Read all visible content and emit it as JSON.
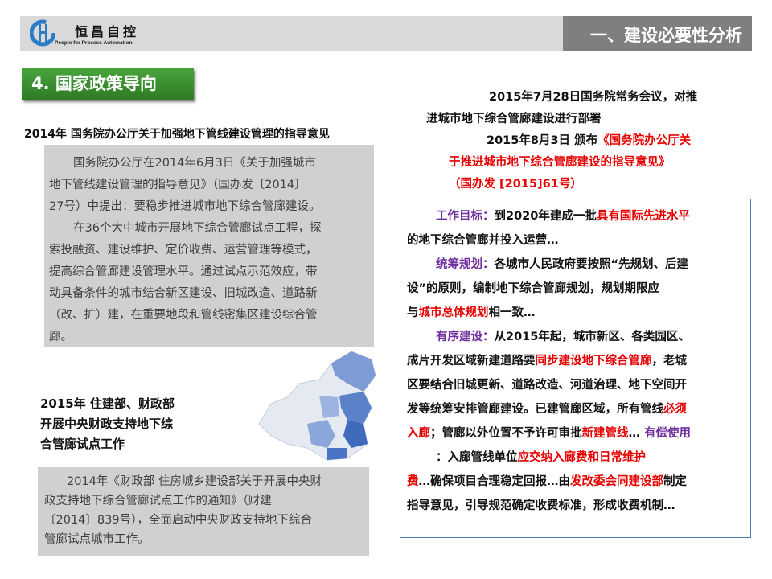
{
  "header": {
    "logo_cn": "恒昌自控",
    "logo_en": "People for Process Automation",
    "section_title": "一、建设必要性分析"
  },
  "tag": "4. 国家政策导向",
  "policy_2014": {
    "title": "2014年 国务院办公厅关于加强地下管线建设管理的指导意见",
    "lines": [
      "国务院办公厅在2014年6月3日《关于加强城市",
      "地下管线建设管理的指导意见》（国办发〔2014〕",
      "27号）中提出：要稳步推进城市地下综合管廊建设。",
      "在36个大中城市开展地下综合管廊试点工程，探",
      "索投融资、建设维护、定价收费、运营管理等模式，",
      "提高综合管廊建设管理水平。通过试点示范效应，带",
      "动具备条件的城市结合新区建设、旧城改造、道路新",
      "（改、扩）建，在重要地段和管线密集区建设综合管",
      "廊。"
    ]
  },
  "policy_2015": {
    "title_lines": [
      "2015年 住建部、财政部",
      "开展中央财政支持地下综",
      "合管廊试点工作"
    ],
    "lines": [
      "2014年《财政部 住房城乡建设部关于开展中央财",
      "政支持地下综合管廊试点工作的通知》（财建",
      "〔2014〕839号），全面启动中央财政支持地下综合",
      "管廊试点城市工作。"
    ]
  },
  "right_top": {
    "l1": "2015年7月28日国务院常务会议，对推",
    "l2": "进城市地下综合管廊建设进行部署",
    "l3a": "2015年8月3日 颁布",
    "l3b": "《国务院办公厅关",
    "l4": "于推进城市地下综合管廊建设的指导意见》",
    "l5": "（国办发 [2015]61号）"
  },
  "box": {
    "p1_label": "工作目标：",
    "p1a": "到2020年建成一批",
    "p1b": "具有国际先进水平",
    "p1c": "的地下综合管廊并投入运营…",
    "p2_label": "统筹规划：",
    "p2a": "各城市人民政府要按照“先规划、后建",
    "p2b": "设”的原则，编制地下综合管廊规划，规划期限应",
    "p2c": "与",
    "p2d": "城市总体规划",
    "p2e": "相一致…",
    "p3_label": "有序建设：",
    "p3a": "从2015年起，城市新区、各类园区、",
    "p3b": "成片开发区域新建道路要",
    "p3c": "同步建设地下综合管廊",
    "p3d": "，老城",
    "p3e": "区要结合旧城更新、道路改造、河道治理、地下空间开",
    "p3f": "发等统筹安排管廊建设。已建管廊区域，所有管线",
    "p3g": "必须",
    "p3h": "入廊",
    "p3i": "；管廊以外位置不予许可审批",
    "p3j": "新建管线",
    "p3k": "… ",
    "p4_label": "有偿使用",
    "p4a": "：入廊管线单位",
    "p4b": "应交纳入廊费和日常维护",
    "p4c": "费",
    "p4d": "…确保项目合理稳定回报…由",
    "p4e": "发改委会同建设部",
    "p4f": "制定",
    "p4g": "指导意见，引导规范确定收费标准，形成收费机制…"
  }
}
